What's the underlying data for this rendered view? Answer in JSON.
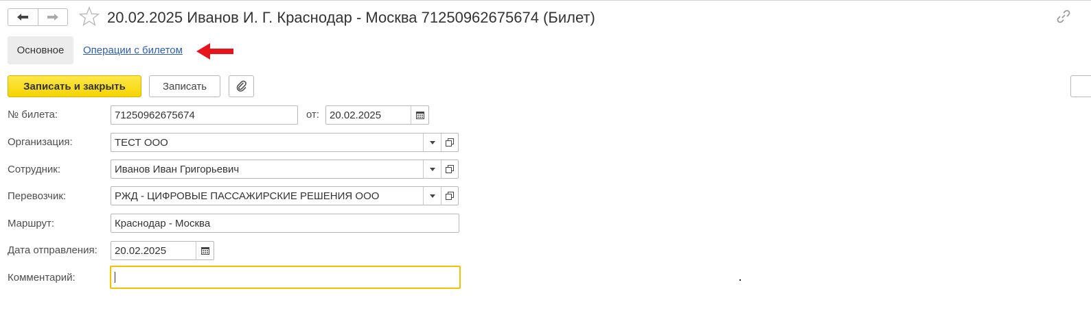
{
  "header": {
    "title": "20.02.2025 Иванов И. Г. Краснодар - Москва 71250962675674 (Билет)",
    "icons": {
      "back": "arrow-left-icon",
      "forward": "arrow-right-icon",
      "favorite": "star-icon",
      "link": "link-icon"
    }
  },
  "tabs": {
    "main_label": "Основное",
    "operations_label": "Операции с билетом"
  },
  "annotation": {
    "arrow_color": "#e8141b"
  },
  "toolbar": {
    "save_close_label": "Записать и закрыть",
    "save_label": "Записать",
    "attach_icon": "paperclip-icon"
  },
  "form": {
    "ticket_number": {
      "label": "№ билета:",
      "value": "71250962675674"
    },
    "date_from": {
      "label": "от:",
      "value": "20.02.2025"
    },
    "organization": {
      "label": "Организация:",
      "value": "ТЕСТ ООО"
    },
    "employee": {
      "label": "Сотрудник:",
      "value": "Иванов Иван Григорьевич"
    },
    "carrier": {
      "label": "Перевозчик:",
      "value": "РЖД - ЦИФРОВЫЕ ПАССАЖИРСКИЕ РЕШЕНИЯ ООО"
    },
    "route": {
      "label": "Маршрут:",
      "value": "Краснодар - Москва"
    },
    "departure_date": {
      "label": "Дата отправления:",
      "value": "20.02.2025"
    },
    "comment": {
      "label": "Комментарий:",
      "value": ""
    }
  },
  "colors": {
    "primary_button": "#f5d400",
    "link": "#2d5eb4",
    "focus_border": "#f2c200"
  }
}
